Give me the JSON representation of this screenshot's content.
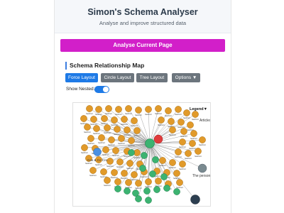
{
  "header": {
    "title": "Simon's Schema Analyser",
    "subtitle": "Analyse and improve structured data"
  },
  "actions": {
    "analyse_label": "Analyse Current Page"
  },
  "map": {
    "title": "Schema Relationship Map",
    "layouts": [
      {
        "label": "Force Layout",
        "active": true
      },
      {
        "label": "Circle Layout",
        "active": false
      },
      {
        "label": "Tree Layout",
        "active": false
      },
      {
        "label": "Options ▼",
        "active": false
      }
    ],
    "show_nested_label": "Show Nested:",
    "show_nested": true,
    "legend_label": "Legend",
    "node_labels": {
      "articles": "Articles",
      "coe": "Coe & Co Cre...",
      "personal": "The personal",
      "hasPart": "hasPart"
    }
  },
  "colors": {
    "accent": "#d21fc9",
    "primary": "#1e7ae6",
    "node_orange": "#e19a2a",
    "node_green": "#3cb371",
    "node_red": "#e03c3c",
    "node_blue": "#4a90e2",
    "node_gray": "#7a8a90",
    "node_navy": "#2c3e50"
  }
}
